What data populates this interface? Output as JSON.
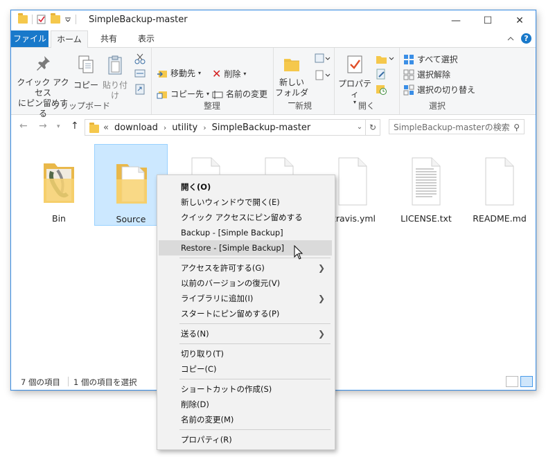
{
  "window": {
    "title": "SimpleBackup-master",
    "minimize": "—",
    "maximize": "☐",
    "close": "✕"
  },
  "ribbon_tabs": [
    "ファイル",
    "ホーム",
    "共有",
    "表示"
  ],
  "ribbon": {
    "clipboard": {
      "label": "クリップボード",
      "pin": "クイック アクセス\nにピン留めする",
      "copy": "コピー",
      "paste": "貼り付け"
    },
    "organize": {
      "label": "整理",
      "move_to": "移動先",
      "copy_to": "コピー先",
      "delete": "削除",
      "rename": "名前の変更"
    },
    "new": {
      "label": "新規",
      "new_folder": "新しい\nフォルダー"
    },
    "open": {
      "label": "開く",
      "properties": "プロパティ"
    },
    "select": {
      "label": "選択",
      "select_all": "すべて選択",
      "select_none": "選択解除",
      "invert": "選択の切り替え"
    }
  },
  "address": {
    "prefix": "«",
    "crumbs": [
      "download",
      "utility",
      "SimpleBackup-master"
    ],
    "search_placeholder": "SimpleBackup-masterの検索"
  },
  "items": [
    {
      "name": "Bin",
      "type": "folder"
    },
    {
      "name": "Source",
      "type": "folder",
      "selected": true
    },
    {
      "name": "",
      "type": "file"
    },
    {
      "name": "",
      "type": "file"
    },
    {
      "name": ".travis.yml",
      "type": "file"
    },
    {
      "name": "LICENSE.txt",
      "type": "text"
    },
    {
      "name": "README.md",
      "type": "file"
    }
  ],
  "status": {
    "count": "7 個の項目",
    "selected": "1 個の項目を選択"
  },
  "context_menu": {
    "items": [
      {
        "label": "開く(O)",
        "bold": true
      },
      {
        "label": "新しいウィンドウで開く(E)"
      },
      {
        "label": "クイック アクセスにピン留めする"
      },
      {
        "label": "Backup - [Simple Backup]"
      },
      {
        "label": "Restore - [Simple Backup]",
        "hover": true
      },
      {
        "label": "アクセスを許可する(G)",
        "submenu": true
      },
      {
        "label": "以前のバージョンの復元(V)"
      },
      {
        "label": "ライブラリに追加(I)",
        "submenu": true
      },
      {
        "label": "スタートにピン留めする(P)"
      },
      {
        "label": "送る(N)",
        "submenu": true
      },
      {
        "label": "切り取り(T)"
      },
      {
        "label": "コピー(C)"
      },
      {
        "label": "ショートカットの作成(S)"
      },
      {
        "label": "削除(D)"
      },
      {
        "label": "名前の変更(M)"
      },
      {
        "label": "プロパティ(R)"
      }
    ],
    "submenu_arrow": "❯"
  },
  "colors": {
    "accent": "#1979ca",
    "selection": "#cce8ff",
    "folder": "#f5c84c"
  }
}
